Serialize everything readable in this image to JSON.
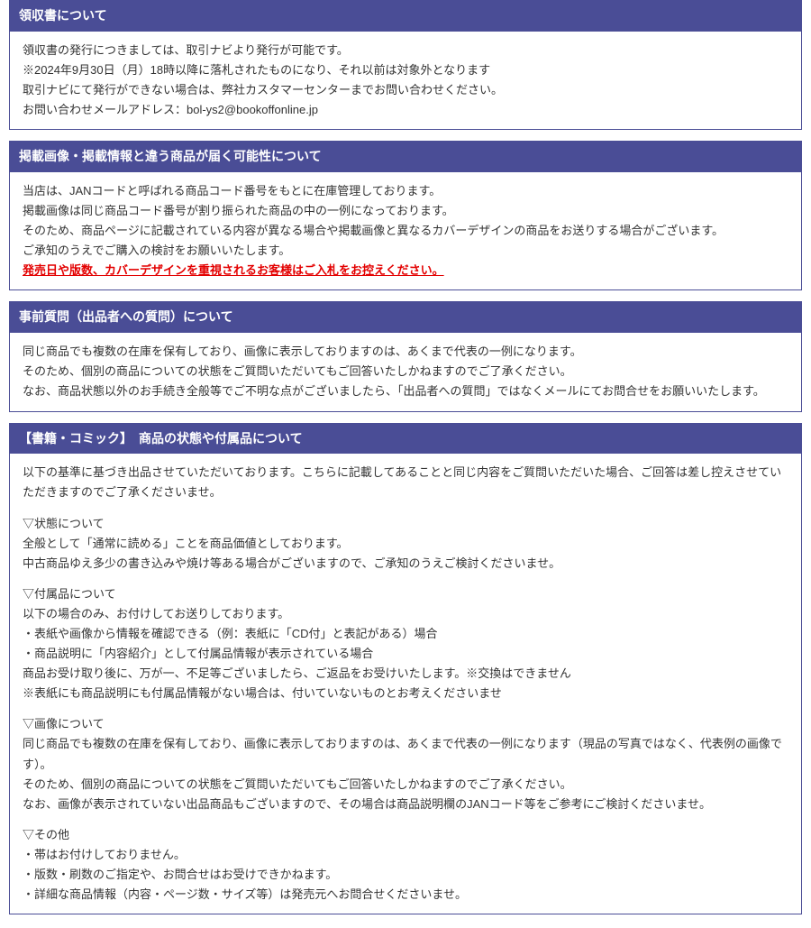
{
  "sections": [
    {
      "title": "領収書について",
      "lines": [
        "領収書の発行につきましては、取引ナビより発行が可能です。",
        "※2024年9月30日（月）18時以降に落札されたものになり、それ以前は対象外となります",
        "取引ナビにて発行ができない場合は、弊社カスタマーセンターまでお問い合わせください。",
        "お問い合わせメールアドレス：bol-ys2@bookoffonline.jp"
      ]
    },
    {
      "title": "掲載画像・掲載情報と違う商品が届く可能性について",
      "lines": [
        "当店は、JANコードと呼ばれる商品コード番号をもとに在庫管理しております。",
        "掲載画像は同じ商品コード番号が割り振られた商品の中の一例になっております。",
        "そのため、商品ページに記載されている内容が異なる場合や掲載画像と異なるカバーデザインの商品をお送りする場合がございます。",
        "ご承知のうえでご購入の検討をお願いいたします。"
      ],
      "red": "発売日や版数、カバーデザインを重視されるお客様はご入札をお控えください。"
    },
    {
      "title": "事前質問（出品者への質問）について",
      "lines": [
        "同じ商品でも複数の在庫を保有しており、画像に表示しておりますのは、あくまで代表の一例になります。",
        "そのため、個別の商品についての状態をご質問いただいてもご回答いたしかねますのでご了承ください。",
        "なお、商品状態以外のお手続き全般等でご不明な点がございましたら、「出品者への質問」ではなくメールにてお問合せをお願いいたします。"
      ]
    }
  ],
  "books": {
    "title": "【書籍・コミック】　商品の状態や付属品について",
    "intro": "以下の基準に基づき出品させていただいております。こちらに記載してあることと同じ内容をご質問いただいた場合、ご回答は差し控えさせていただきますのでご了承くださいませ。",
    "condition_h": "▽状態について",
    "condition_1": "全般として「通常に読める」ことを商品価値としております。",
    "condition_2": "中古商品ゆえ多少の書き込みや焼け等ある場合がございますので、ご承知のうえご検討くださいませ。",
    "accessory_h": "▽付属品について",
    "accessory_1": "以下の場合のみ、お付けしてお送りしております。",
    "accessory_2": "・表紙や画像から情報を確認できる（例：表紙に「CD付」と表記がある）場合",
    "accessory_3": "・商品説明に「内容紹介」として付属品情報が表示されている場合",
    "accessory_4": "商品お受け取り後に、万が一、不足等ございましたら、ご返品をお受けいたします。※交換はできません",
    "accessory_5": "※表紙にも商品説明にも付属品情報がない場合は、付いていないものとお考えくださいませ",
    "image_h": "▽画像について",
    "image_1": "同じ商品でも複数の在庫を保有しており、画像に表示しておりますのは、あくまで代表の一例になります（現品の写真ではなく、代表例の画像です）。",
    "image_2": "そのため、個別の商品についての状態をご質問いただいてもご回答いたしかねますのでご了承ください。",
    "image_3": "なお、画像が表示されていない出品商品もございますので、その場合は商品説明欄のJANコード等をご参考にご検討くださいませ。",
    "other_h": "▽その他",
    "other_1": "・帯はお付けしておりません。",
    "other_2": "・版数・刷数のご指定や、お問合せはお受けできかねます。",
    "other_3": "・詳細な商品情報（内容・ページ数・サイズ等）は発売元へお問合せくださいませ。"
  }
}
